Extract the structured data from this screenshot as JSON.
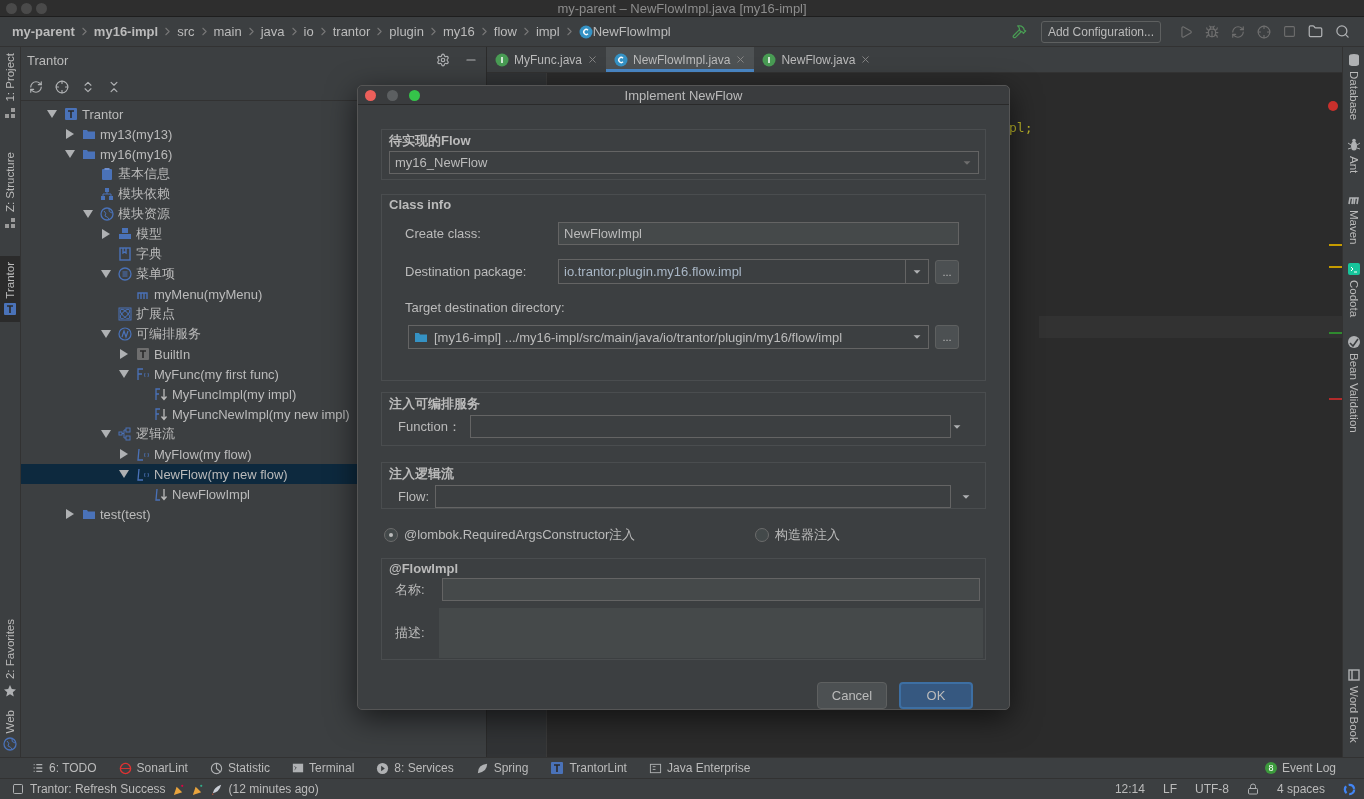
{
  "window": {
    "title": "my-parent – NewFlowImpl.java [my16-impl]"
  },
  "breadcrumbs": [
    {
      "label": "my-parent",
      "kind": "module"
    },
    {
      "label": "my16-impl",
      "kind": "module"
    },
    {
      "label": "src",
      "kind": "folder"
    },
    {
      "label": "main",
      "kind": "folder"
    },
    {
      "label": "java",
      "kind": "folder"
    },
    {
      "label": "io",
      "kind": "folder"
    },
    {
      "label": "trantor",
      "kind": "folder"
    },
    {
      "label": "plugin",
      "kind": "folder"
    },
    {
      "label": "my16",
      "kind": "folder"
    },
    {
      "label": "flow",
      "kind": "folder"
    },
    {
      "label": "impl",
      "kind": "folder"
    },
    {
      "label": "NewFlowImpl",
      "kind": "class"
    }
  ],
  "run_config": "Add Configuration...",
  "left_stripe": [
    {
      "label": "1: Project",
      "kind": "folder",
      "selected": false
    },
    {
      "label": "Z: Structure",
      "kind": "structure",
      "selected": false
    },
    {
      "label": "Trantor",
      "kind": "trantor",
      "selected": true
    },
    {
      "label": "2: Favorites",
      "kind": "star",
      "selected": false
    },
    {
      "label": "Web",
      "kind": "globe",
      "selected": false
    }
  ],
  "tool_window": {
    "title": "Trantor",
    "tree": [
      {
        "label": "Trantor",
        "kind": "trantor",
        "selected": false,
        "expanded": true,
        "children": [
          {
            "label": "my13(my13)",
            "kind": "folder",
            "selected": false,
            "expanded": false
          },
          {
            "label": "my16(my16)",
            "kind": "folder",
            "selected": false,
            "expanded": true,
            "children": [
              {
                "label": "基本信息",
                "kind": "info",
                "selected": false
              },
              {
                "label": "模块依赖",
                "kind": "hierarchy",
                "selected": false
              },
              {
                "label": "模块资源",
                "kind": "globe",
                "selected": false,
                "expanded": true,
                "children": [
                  {
                    "label": "模型",
                    "kind": "model",
                    "selected": false,
                    "expanded": false
                  },
                  {
                    "label": "字典",
                    "kind": "dict",
                    "selected": false
                  },
                  {
                    "label": "菜单项",
                    "kind": "menu",
                    "selected": false,
                    "expanded": true,
                    "children": [
                      {
                        "label": "myMenu(myMenu)",
                        "kind": "m",
                        "selected": false
                      }
                    ]
                  },
                  {
                    "label": "扩展点",
                    "kind": "ext",
                    "selected": false
                  },
                  {
                    "label": "可编排服务",
                    "kind": "service",
                    "selected": false,
                    "expanded": true,
                    "children": [
                      {
                        "label": "BuiltIn",
                        "kind": "builtin",
                        "selected": false,
                        "expanded": false
                      },
                      {
                        "label": "MyFunc(my first func)",
                        "kind": "func",
                        "selected": false,
                        "expanded": true,
                        "children": [
                          {
                            "label": "MyFuncImpl(my impl)",
                            "kind": "func-impl",
                            "selected": false
                          },
                          {
                            "label": "MyFuncNewImpl(my new impl)",
                            "kind": "func-impl",
                            "selected": false
                          }
                        ]
                      }
                    ]
                  },
                  {
                    "label": "逻辑流",
                    "kind": "flow-group",
                    "selected": false,
                    "expanded": true,
                    "children": [
                      {
                        "label": "MyFlow(my flow)",
                        "kind": "flow",
                        "selected": false,
                        "expanded": false
                      },
                      {
                        "label": "NewFlow(my new flow)",
                        "kind": "flow",
                        "selected": true,
                        "expanded": true,
                        "children": [
                          {
                            "label": "NewFlowImpl",
                            "kind": "flow-impl",
                            "selected": false
                          }
                        ]
                      }
                    ]
                  }
                ]
              }
            ]
          },
          {
            "label": "test(test)",
            "kind": "folder",
            "selected": false,
            "expanded": false
          }
        ]
      }
    ]
  },
  "editor": {
    "tabs": [
      {
        "label": "MyFunc.java",
        "kind": "interface",
        "selected": false
      },
      {
        "label": "NewFlowImpl.java",
        "kind": "class",
        "selected": true
      },
      {
        "label": "NewFlow.java",
        "kind": "interface",
        "selected": false
      }
    ],
    "code_fragment": "pl;"
  },
  "right_stripe": [
    {
      "label": "Database",
      "kind": "database"
    },
    {
      "label": "Ant",
      "kind": "bug"
    },
    {
      "label": "Maven",
      "kind": "maven"
    },
    {
      "label": "Codota",
      "kind": "codota"
    },
    {
      "label": "Bean Validation",
      "kind": "bean"
    },
    {
      "label": "Word Book",
      "kind": "book"
    }
  ],
  "dialog": {
    "title": "Implement NewFlow",
    "flow_group": {
      "label": "待实现的Flow",
      "value": "my16_NewFlow"
    },
    "class_info": {
      "label": "Class info",
      "create_class_label": "Create class:",
      "create_class_value": "NewFlowImpl",
      "package_label": "Destination package:",
      "package_value": "io.trantor.plugin.my16.flow.impl",
      "browse": "...",
      "directory_label": "Target destination directory:",
      "directory_value": "[my16-impl] .../my16-impl/src/main/java/io/trantor/plugin/my16/flow/impl",
      "directory_browse": "..."
    },
    "service_group": {
      "label": "注入可编排服务",
      "field_label": "Function："
    },
    "flow_inject_group": {
      "label": "注入逻辑流",
      "field_label": "Flow:"
    },
    "radios": [
      {
        "label": "@lombok.RequiredArgsConstructor注入",
        "selected": true
      },
      {
        "label": "构造器注入",
        "selected": false
      }
    ],
    "flowimpl_group": {
      "label": "@FlowImpl",
      "name_label": "名称:",
      "desc_label": "描述:"
    },
    "buttons": [
      {
        "label": "Cancel",
        "kind": "secondary"
      },
      {
        "label": "OK",
        "kind": "primary"
      }
    ]
  },
  "bottom_tools": [
    {
      "label": "6: TODO",
      "kind": "list"
    },
    {
      "label": "SonarLint",
      "kind": "sonar"
    },
    {
      "label": "Statistic",
      "kind": "pie"
    },
    {
      "label": "Terminal",
      "kind": "terminal"
    },
    {
      "label": "8: Services",
      "kind": "play"
    },
    {
      "label": "Spring",
      "kind": "leaf"
    },
    {
      "label": "TrantorLint",
      "kind": "trantor"
    },
    {
      "label": "Java Enterprise",
      "kind": "javaee"
    }
  ],
  "event_log": {
    "label": "Event Log",
    "badge": "8"
  },
  "status_bar": {
    "message": "Trantor: Refresh Success",
    "time_ago": "(12 minutes ago)",
    "position": "12:14",
    "line_separator": "LF",
    "encoding": "UTF-8",
    "indent": "4 spaces"
  }
}
